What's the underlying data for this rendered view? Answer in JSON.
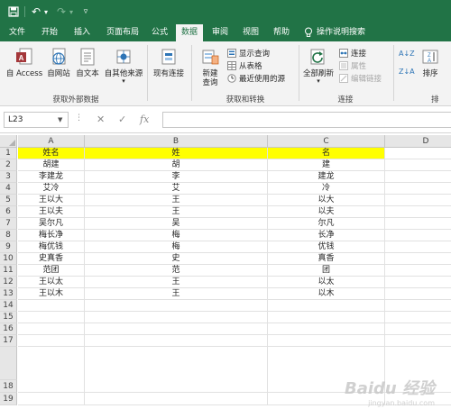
{
  "colors": {
    "brand": "#217346",
    "ribbon_bg": "#f3f3f3",
    "highlight": "#ffff00"
  },
  "quick_access": {
    "save_icon": "save-icon",
    "undo_icon": "undo-icon",
    "redo_icon": "redo-icon",
    "customize_icon": "customize-icon",
    "undo_symbol": "↶",
    "redo_symbol": "↷",
    "dropdown_symbol": "▾",
    "customize_symbol": "▿"
  },
  "tabs": [
    "文件",
    "开始",
    "插入",
    "页面布局",
    "公式",
    "数据",
    "审阅",
    "视图",
    "帮助"
  ],
  "active_tab": "数据",
  "tell_me": {
    "label": "操作说明搜索",
    "icon": "lightbulb-icon"
  },
  "ribbon": {
    "get_external": {
      "label": "获取外部数据",
      "buttons": [
        "自 Access",
        "自网站",
        "自文本",
        "自其他来源"
      ],
      "dropdown": "▾"
    },
    "existing_connections": "现有连接",
    "get_transform": {
      "label": "获取和转换",
      "new_query": "新建\n查询",
      "new_query_dropdown": "▾",
      "small": [
        "显示查询",
        "从表格",
        "最近使用的源"
      ]
    },
    "connections": {
      "label": "连接",
      "refresh_all": "全部刷新",
      "refresh_dropdown": "▾",
      "small": [
        "连接",
        "属性",
        "编辑链接"
      ]
    },
    "sort": {
      "label": "排序",
      "az": "A↓Z",
      "za": "Z↓A"
    }
  },
  "formula_bar": {
    "name_box": "L23",
    "cancel": "✕",
    "enter": "✓",
    "fx": "fx",
    "value": ""
  },
  "sheet": {
    "columns": [
      "A",
      "B",
      "C",
      "D"
    ],
    "rows": [
      {
        "n": "1",
        "a": "姓名",
        "b": "姓",
        "c": "名",
        "highlight": true
      },
      {
        "n": "2",
        "a": "胡建",
        "b": "胡",
        "c": "建"
      },
      {
        "n": "3",
        "a": "李建龙",
        "b": "李",
        "c": "建龙"
      },
      {
        "n": "4",
        "a": "艾冷",
        "b": "艾",
        "c": "冷"
      },
      {
        "n": "5",
        "a": "王以大",
        "b": "王",
        "c": "以大"
      },
      {
        "n": "6",
        "a": "王以夫",
        "b": "王",
        "c": "以夫"
      },
      {
        "n": "7",
        "a": "吴尔凡",
        "b": "吴",
        "c": "尔凡"
      },
      {
        "n": "8",
        "a": "梅长净",
        "b": "梅",
        "c": "长净"
      },
      {
        "n": "9",
        "a": "梅优钱",
        "b": "梅",
        "c": "优钱"
      },
      {
        "n": "10",
        "a": "史真香",
        "b": "史",
        "c": "真香"
      },
      {
        "n": "11",
        "a": "范团",
        "b": "范",
        "c": "团"
      },
      {
        "n": "12",
        "a": "王以太",
        "b": "王",
        "c": "以太"
      },
      {
        "n": "13",
        "a": "王以木",
        "b": "王",
        "c": "以木"
      },
      {
        "n": "14",
        "a": "",
        "b": "",
        "c": ""
      },
      {
        "n": "15",
        "a": "",
        "b": "",
        "c": ""
      },
      {
        "n": "16",
        "a": "",
        "b": "",
        "c": ""
      },
      {
        "n": "17",
        "a": "",
        "b": "",
        "c": ""
      }
    ],
    "lower_rows": [
      "18",
      "19"
    ]
  },
  "watermark": {
    "text": "Baidu 经验",
    "sub": "jingyan.baidu.com"
  }
}
